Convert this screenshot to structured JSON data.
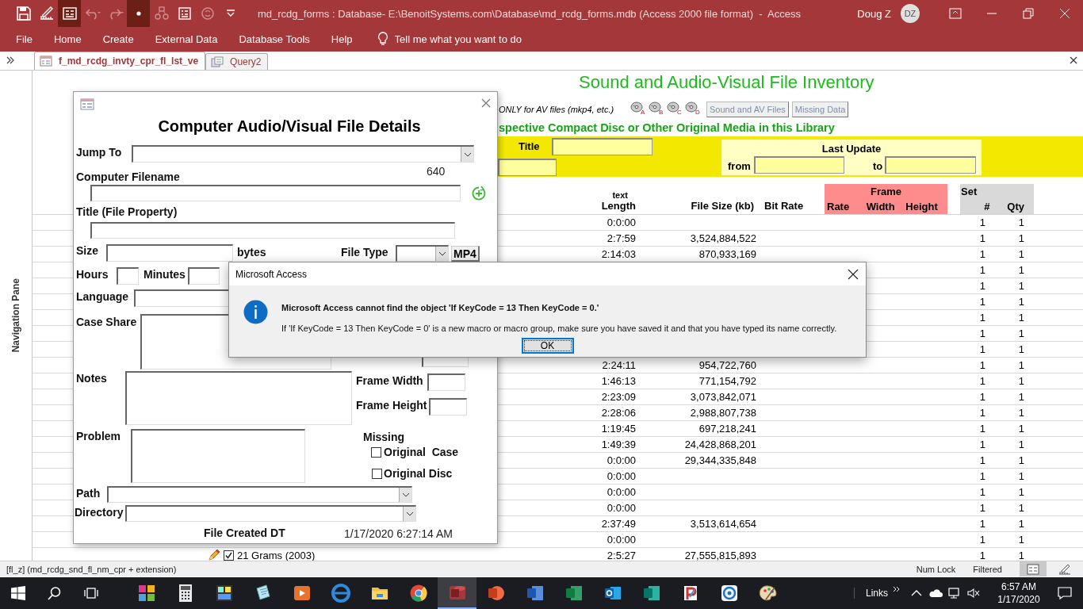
{
  "window": {
    "title": "md_rcdg_forms : Database- E:\\BenoitSystems.com\\Database\\md_rcdg_forms.mdb (Access 2000 file format)  -  Access",
    "user": "Doug Z",
    "user_initials": "DZ"
  },
  "menu": [
    "File",
    "Home",
    "Create",
    "External Data",
    "Database Tools",
    "Help"
  ],
  "search": {
    "placeholder": "Tell me what you want to do"
  },
  "doc_tabs": [
    {
      "label": "f_md_rcdg_invty_cpr_fl_lst_ve",
      "selected": true
    },
    {
      "label": "Query2",
      "selected": false
    }
  ],
  "nav_pane": {
    "label": "Navigation Pane"
  },
  "inventory_form": {
    "title": "Sound and Audio-Visual File Inventory",
    "note": "ONLY for AV files (mkp4, etc.)",
    "disc_buttons": [
      "A",
      "B",
      "C",
      "D"
    ],
    "buttons": [
      "Sound and AV Files",
      "Missing Data"
    ],
    "subtitle": "spective Compact Disc or Other Original Media in this Library",
    "filter": {
      "title_label": "Title",
      "last_update_label": "Last Update",
      "from_label": "from",
      "to_label": "to"
    },
    "columns": {
      "length_caption": "text",
      "length": "Length",
      "file_size": "File Size (kb)",
      "bit_rate": "Bit Rate",
      "frame_group": "Frame",
      "frame_rate": "Rate",
      "frame_width": "Width",
      "frame_height": "Height",
      "set_group": "Set",
      "set_number": "#",
      "set_qty": "Qty"
    },
    "rows": [
      {
        "length": "0:0:00",
        "set_number": "1",
        "qty": "1"
      },
      {
        "length": "2:7:59",
        "file_size": "3,524,884,522",
        "set_number": "1",
        "qty": "1"
      },
      {
        "length": "2:14:03",
        "file_size": "870,933,169",
        "set_number": "1",
        "qty": "1"
      },
      {
        "set_number": "1",
        "qty": "1"
      },
      {
        "set_number": "1",
        "qty": "1"
      },
      {
        "set_number": "1",
        "qty": "1"
      },
      {
        "set_number": "1",
        "qty": "1"
      },
      {
        "set_number": "1",
        "qty": "1"
      },
      {
        "set_number": "1",
        "qty": "1"
      },
      {
        "length": "2:24:11",
        "file_size": "954,722,760",
        "set_number": "1",
        "qty": "1"
      },
      {
        "length": "1:46:13",
        "file_size": "771,154,792",
        "set_number": "1",
        "qty": "1"
      },
      {
        "length": "2:23:09",
        "file_size": "3,073,842,071",
        "set_number": "1",
        "qty": "1"
      },
      {
        "length": "2:28:06",
        "file_size": "2,988,807,738",
        "set_number": "1",
        "qty": "1"
      },
      {
        "length": "1:19:45",
        "file_size": "697,218,241",
        "set_number": "1",
        "qty": "1"
      },
      {
        "length": "1:49:39",
        "file_size": "24,428,868,201",
        "set_number": "1",
        "qty": "1"
      },
      {
        "length": "0:0:00",
        "file_size": "29,344,335,848",
        "set_number": "1",
        "qty": "1"
      },
      {
        "length": "0:0:00",
        "set_number": "1",
        "qty": "1"
      },
      {
        "length": "0:0:00",
        "set_number": "1",
        "qty": "1"
      },
      {
        "length": "0:0:00",
        "set_number": "1",
        "qty": "1"
      },
      {
        "length": "2:37:49",
        "file_size": "3,513,614,654",
        "set_number": "1",
        "qty": "1"
      },
      {
        "length": "0:0:00",
        "set_number": "1",
        "qty": "1"
      },
      {
        "record": {
          "title": "21 Grams (2003)",
          "checked": true,
          "editing": true
        },
        "length": "2:5:27",
        "file_size": "27,555,815,893",
        "set_number": "1",
        "qty": "1"
      }
    ]
  },
  "detail_form": {
    "title": "Computer Audio/Visual File Details",
    "jump_to_label": "Jump To",
    "record_count": "640",
    "filename_label": "Computer Filename",
    "file_title_label": "Title (File Property)",
    "size_label": "Size",
    "size_unit": "bytes",
    "file_type_label": "File Type",
    "file_type_button": "MP4",
    "hours_label": "Hours",
    "minutes_label": "Minutes",
    "language_label": "Language",
    "case_share_label": "Case Share",
    "notes_label": "Notes",
    "frame_width_label": "Frame Width",
    "frame_height_label": "Frame Height",
    "problem_label": "Problem",
    "missing_label": "Missing",
    "missing_options": [
      {
        "label": "Original  Case",
        "checked": false
      },
      {
        "label": "Original Disc",
        "checked": false
      }
    ],
    "path_label": "Path",
    "directory_label": "Directory",
    "created_label": "File Created DT",
    "created_value": "1/17/2020 6:27:14 AM"
  },
  "dialog": {
    "title": "Microsoft Access",
    "message": "Microsoft Access cannot find the object 'If KeyCode = 13 Then KeyCode = 0.'",
    "detail": "If 'If KeyCode = 13 Then KeyCode = 0' is a new macro or macro group, make sure you have saved it and that you have typed its name correctly.",
    "button": "OK"
  },
  "status_bar": {
    "hint": "[fl_z] (md_rcdg_snd_fl_nm_cpr + extension)",
    "indicators": [
      "Num Lock",
      "Filtered"
    ]
  },
  "taskbar": {
    "links": "Links",
    "time": "6:57 AM",
    "date": "1/17/2020"
  }
}
